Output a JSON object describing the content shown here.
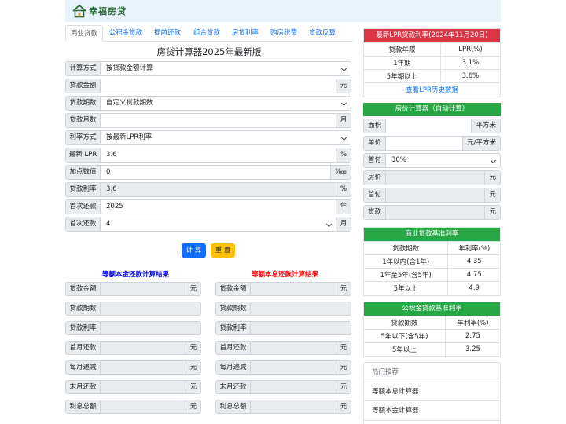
{
  "brand": {
    "logo_text": "幸福房贷"
  },
  "tabs": [
    {
      "label": "商业贷款",
      "active": true
    },
    {
      "label": "公积金贷款"
    },
    {
      "label": "提前还款"
    },
    {
      "label": "组合贷款"
    },
    {
      "label": "房贷利率"
    },
    {
      "label": "购房税费"
    },
    {
      "label": "贷款反算"
    }
  ],
  "calculator": {
    "title": "房贷计算器2025年最新版",
    "rows": [
      {
        "label": "计算方式",
        "value": "按贷款金额计算",
        "type": "select"
      },
      {
        "label": "贷款金额",
        "value": "",
        "unit": "元"
      },
      {
        "label": "贷款期数",
        "value": "自定义贷款期数",
        "type": "select"
      },
      {
        "label": "贷款月数",
        "value": "",
        "unit": "月"
      },
      {
        "label": "利率方式",
        "value": "按最新LPR利率",
        "type": "select"
      },
      {
        "label": "最新 LPR",
        "value": "3.6",
        "unit": "%"
      },
      {
        "label": "加点数值",
        "value": "0",
        "unit": "‱"
      },
      {
        "label": "贷款利率",
        "value": "3.6",
        "unit": "%",
        "readonly": true
      },
      {
        "label": "首次还款",
        "value": "2025",
        "unit": "年"
      },
      {
        "label": "首次还款",
        "value": "4",
        "unit": "月",
        "type": "select"
      }
    ],
    "calc_button": "计 算",
    "reset_button": "重 置"
  },
  "results": {
    "principal_title": "等额本金还款计算结果",
    "interest_title": "等额本息还款计算结果",
    "principal_rows": [
      {
        "label": "贷款金额",
        "unit": "元"
      },
      {
        "label": "贷款期数"
      },
      {
        "label": "贷款利率"
      },
      {
        "label": "首月还款",
        "unit": "元"
      },
      {
        "label": "每月递减",
        "unit": "元"
      },
      {
        "label": "末月还款",
        "unit": "元"
      },
      {
        "label": "利息总额",
        "unit": "元"
      }
    ],
    "interest_rows": [
      {
        "label": "贷款金额",
        "unit": "元"
      },
      {
        "label": "贷款期数"
      },
      {
        "label": "贷款利率"
      },
      {
        "label": "首月还款",
        "unit": "元"
      },
      {
        "label": "每月递减",
        "unit": "元"
      },
      {
        "label": "末月还款",
        "unit": "元"
      },
      {
        "label": "利息总额",
        "unit": "元"
      }
    ]
  },
  "lpr_card": {
    "title": "最新LPR贷款利率(2024年11月20日)",
    "headers": [
      "贷款年限",
      "LPR(%)"
    ],
    "rows": [
      [
        "1年期",
        "3.1%"
      ],
      [
        "5年期以上",
        "3.6%"
      ]
    ],
    "link": "查看LPR历史数据"
  },
  "house_calc": {
    "title": "房价计算器（自动计算）",
    "rows": [
      {
        "label": "面积",
        "value": "",
        "unit": "平方米"
      },
      {
        "label": "单价",
        "value": "",
        "unit": "元/平方米"
      },
      {
        "label": "首付",
        "value": "30%",
        "type": "select"
      },
      {
        "label": "房价",
        "value": "",
        "unit": "元",
        "readonly": true
      },
      {
        "label": "首付",
        "value": "",
        "unit": "元",
        "readonly": true
      },
      {
        "label": "贷款",
        "value": "",
        "unit": "元",
        "readonly": true
      }
    ]
  },
  "commercial_rates": {
    "title": "商业贷款基准利率",
    "headers": [
      "贷款期数",
      "年利率(%)"
    ],
    "rows": [
      [
        "1年以内(含1年)",
        "4.35"
      ],
      [
        "1年至5年(含5年)",
        "4.75"
      ],
      [
        "5年以上",
        "4.9"
      ]
    ]
  },
  "fund_rates": {
    "title": "公积金贷款基准利率",
    "headers": [
      "贷款期数",
      "年利率(%)"
    ],
    "rows": [
      [
        "5年以下(含5年)",
        "2.75"
      ],
      [
        "5年以上",
        "3.25"
      ]
    ]
  },
  "recommend": {
    "title": "热门推荐",
    "items": [
      "等额本息计算器",
      "等额本金计算器"
    ]
  },
  "colors": {
    "primary": "#0d6efd",
    "red": "#dc3545",
    "green": "#28a745",
    "yellow": "#ffc107",
    "principal_title": "#0000ff",
    "interest_title": "#ff0000"
  }
}
